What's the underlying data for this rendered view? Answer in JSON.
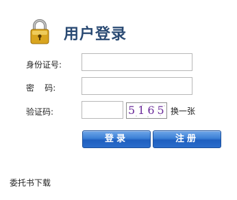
{
  "header": {
    "title": "用户登录",
    "icon": "lock-icon"
  },
  "form": {
    "id_label": "身份证号:",
    "id_value": "",
    "password_label": "密    码:",
    "password_value": "",
    "captcha_label": "验证码:",
    "captcha_value": "",
    "captcha_image_text": "5165",
    "refresh_label": "换一张"
  },
  "buttons": {
    "login_label": "登录",
    "register_label": "注册"
  },
  "footer": {
    "download_label": "委托书下载"
  },
  "colors": {
    "title": "#2a4a73",
    "button_top": "#6fa6e8",
    "button_bottom": "#1f5fbf",
    "captcha_text": "#6a2a9a"
  }
}
